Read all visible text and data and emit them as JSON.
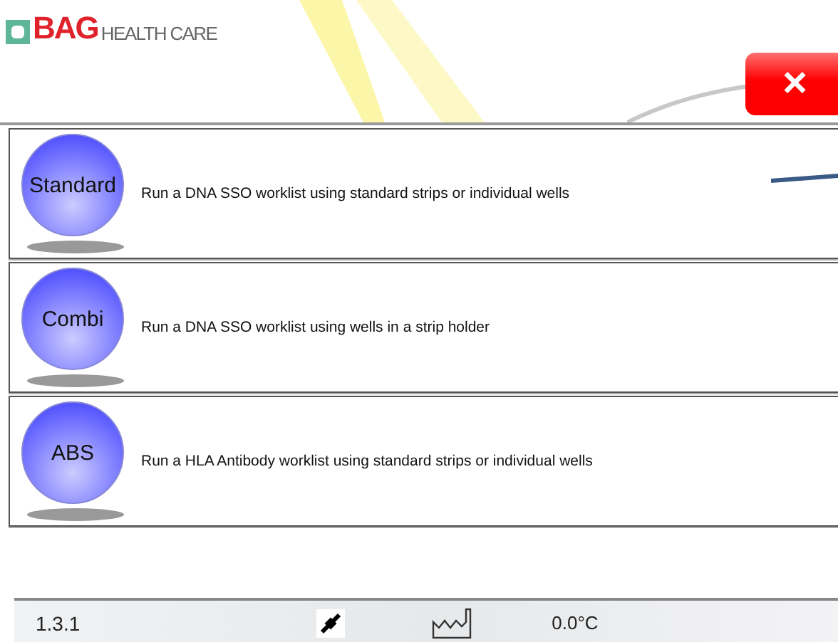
{
  "header": {
    "logo_brand": "BAG",
    "logo_sub": "HEALTH CARE",
    "close_button": "×"
  },
  "options": [
    {
      "label": "Standard",
      "description": "Run a DNA SSO worklist using standard strips or individual wells"
    },
    {
      "label": "Combi",
      "description": "Run a DNA SSO worklist using wells in a strip holder"
    },
    {
      "label": "ABS",
      "description": "Run a HLA Antibody worklist using standard strips or individual wells"
    }
  ],
  "status_bar": {
    "version": "1.3.1",
    "temperature": "0.0°C"
  }
}
